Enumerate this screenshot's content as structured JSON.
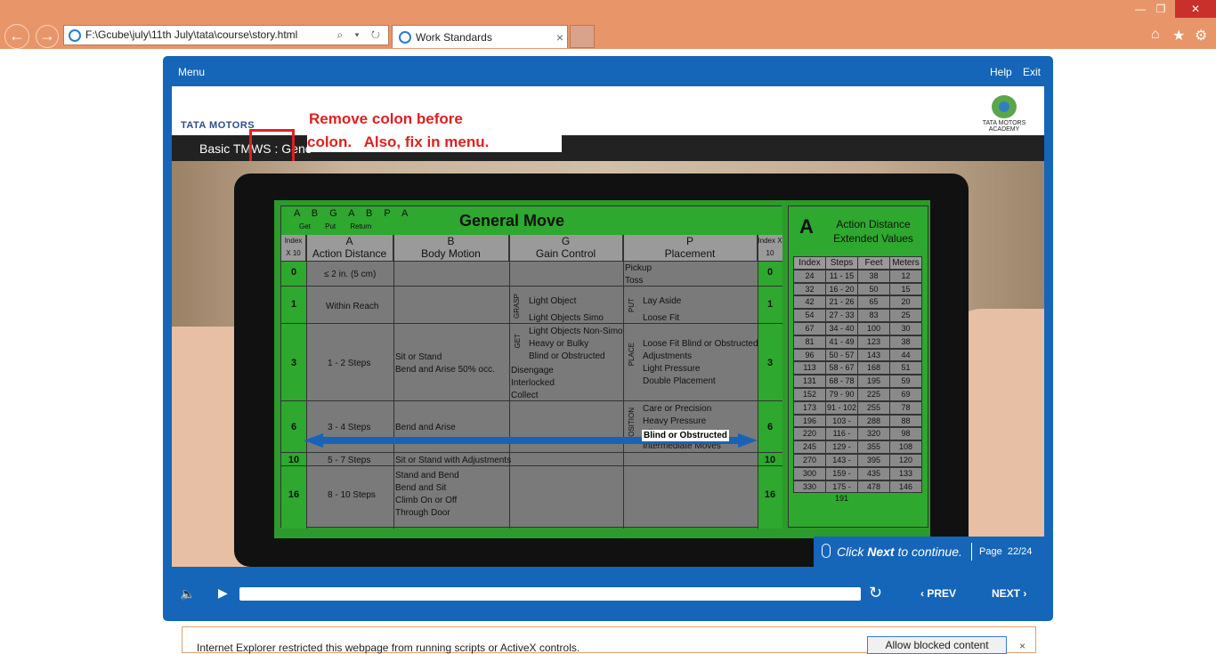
{
  "browser": {
    "address_url": "F:\\Gcube\\july\\11th July\\tata\\course\\story.html",
    "address_tools": "⌕ ▾ ↻",
    "tab_title": "Work Standards",
    "tab_close": "×",
    "back_glyph": "←",
    "forward_glyph": "→",
    "minimize_glyph": "—",
    "restore_glyph": "❐",
    "close_glyph": "✕",
    "home_glyph": "⌂",
    "favorites_glyph": "★",
    "settings_glyph": "⚙"
  },
  "player": {
    "menu_label": "Menu",
    "help_label": "Help",
    "exit_label": "Exit",
    "accent_color": "#1565b8"
  },
  "slide": {
    "brand_left": "TATA MOTORS",
    "brand_right": "TATA MOTORS ACADEMY",
    "title": "Basic TMWS : Gene",
    "review_note_line1": "Remove colon before",
    "review_note_line2": "colon.   Also, fix in menu.",
    "review_color": "#e02020"
  },
  "general_move": {
    "title": "General Move",
    "sequence": "A B G A B P A",
    "sequence_labels": "Get Put Return",
    "index_header": "Index X 10",
    "columns": [
      {
        "letter": "A",
        "name": "Action Distance"
      },
      {
        "letter": "B",
        "name": "Body Motion"
      },
      {
        "letter": "G",
        "name": "Gain Control"
      },
      {
        "letter": "P",
        "name": "Placement"
      }
    ],
    "rows": [
      {
        "index": "0",
        "a": "≤ 2 in. (5 cm)",
        "b": "",
        "g": "",
        "p": "Pickup\nToss"
      },
      {
        "index": "1",
        "a": "Within Reach",
        "b": "",
        "g_group": "GRASP",
        "g": "Light Object\nLight Objects Simo",
        "p_group": "PUT",
        "p": "Lay Aside\nLoose Fit"
      },
      {
        "index": "3",
        "a": "1 - 2 Steps",
        "b": "Sit or Stand\nBend and Arise 50% occ.",
        "g_group": "GET",
        "g": "Light Objects Non-Simo\nHeavy or Bulky\nBlind or Obstructed",
        "g2": "Disengage\nInterlocked\nCollect",
        "p_group": "PLACE",
        "p": "Loose Fit Blind or Obstructed\nAdjustments\nLight Pressure\nDouble Placement"
      },
      {
        "index": "6",
        "a": "3 - 4 Steps",
        "b": "Bend and Arise",
        "g": "",
        "p_group": "POSITION",
        "p": "Care or Precision\nHeavy Pressure\nBlind or Obstructed\nIntermediate Moves"
      },
      {
        "index": "10",
        "a": "5 - 7 Steps",
        "b": "Sit or Stand with Adjustments",
        "g": "",
        "p": ""
      },
      {
        "index": "16",
        "a": "8 - 10 Steps",
        "b": "Stand and Bend\nBend and Sit\nClimb On or Off\nThrough Door",
        "g": "",
        "p": ""
      }
    ],
    "highlight_label": "Blind or Obstructed"
  },
  "action_distance": {
    "letter": "A",
    "title": "Action Distance Extended Values",
    "headers": [
      "Index",
      "Steps",
      "Feet",
      "Meters"
    ],
    "rows": [
      [
        "24",
        "11 - 15",
        "38",
        "12"
      ],
      [
        "32",
        "16 - 20",
        "50",
        "15"
      ],
      [
        "42",
        "21 - 26",
        "65",
        "20"
      ],
      [
        "54",
        "27 - 33",
        "83",
        "25"
      ],
      [
        "67",
        "34 - 40",
        "100",
        "30"
      ],
      [
        "81",
        "41 - 49",
        "123",
        "38"
      ],
      [
        "96",
        "50 - 57",
        "143",
        "44"
      ],
      [
        "113",
        "58 - 67",
        "168",
        "51"
      ],
      [
        "131",
        "68 - 78",
        "195",
        "59"
      ],
      [
        "152",
        "79 - 90",
        "225",
        "69"
      ],
      [
        "173",
        "91 - 102",
        "255",
        "78"
      ],
      [
        "196",
        "103 - 115",
        "288",
        "88"
      ],
      [
        "220",
        "116 - 128",
        "320",
        "98"
      ],
      [
        "245",
        "129 - 142",
        "355",
        "108"
      ],
      [
        "270",
        "143 - 158",
        "395",
        "120"
      ],
      [
        "300",
        "159 - 174",
        "435",
        "133"
      ],
      [
        "330",
        "175 - 191",
        "478",
        "146"
      ]
    ]
  },
  "continue_bar": {
    "prefix": "Click ",
    "bold": "Next",
    "suffix": " to continue.",
    "page_label": "Page",
    "page_value": "22/24"
  },
  "controls": {
    "volume_glyph": "🔈",
    "play_glyph": "▶",
    "replay_glyph": "↻",
    "prev_label": "‹  PREV",
    "next_label": "NEXT  ›",
    "progress": 1.0
  },
  "ie_bar": {
    "message": "Internet Explorer restricted this webpage from running scripts or ActiveX controls.",
    "button": "Allow blocked content",
    "close": "×"
  }
}
